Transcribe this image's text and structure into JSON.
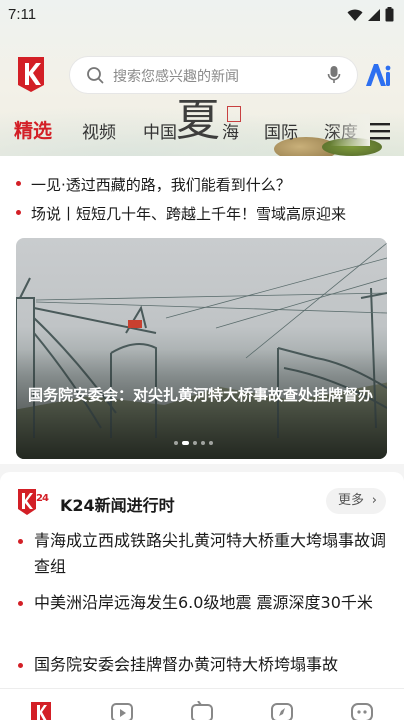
{
  "status_bar": {
    "time": "7:11"
  },
  "header": {
    "search_placeholder": "搜索您感兴趣的新闻",
    "logo_icon": "k-logo-icon",
    "ai_label": "Ai",
    "calligraphy": "夏",
    "tabs": [
      {
        "label": "精选",
        "active": true
      },
      {
        "label": "视频"
      },
      {
        "label": "中国"
      },
      {
        "label": "海"
      },
      {
        "label": "国际"
      },
      {
        "label": "深度"
      }
    ],
    "menu_icon": "hamburger-menu-icon"
  },
  "headlines": [
    "一见·透过西藏的路，我们能看到什么？",
    "场说丨短短几十年、跨越上千年！雪域高原迎来"
  ],
  "banner": {
    "caption": "国务院安委会：对尖扎黄河特大桥事故查处挂牌督办",
    "slide_count": 5,
    "active_slide": 1
  },
  "section": {
    "title": "K24新闻进行时",
    "more_label": "更多",
    "items": [
      "青海成立西成铁路尖扎黄河特大桥重大垮塌事故调查组",
      "中美洲沿岸远海发生6.0级地震 震源深度30千米",
      "国务院安委会挂牌督办黄河特大桥垮塌事故"
    ]
  },
  "bottom_nav": {
    "items": [
      "home-icon",
      "video-icon",
      "tv-icon",
      "discover-icon",
      "profile-icon"
    ]
  },
  "colors": {
    "brand_red": "#d31f26"
  }
}
